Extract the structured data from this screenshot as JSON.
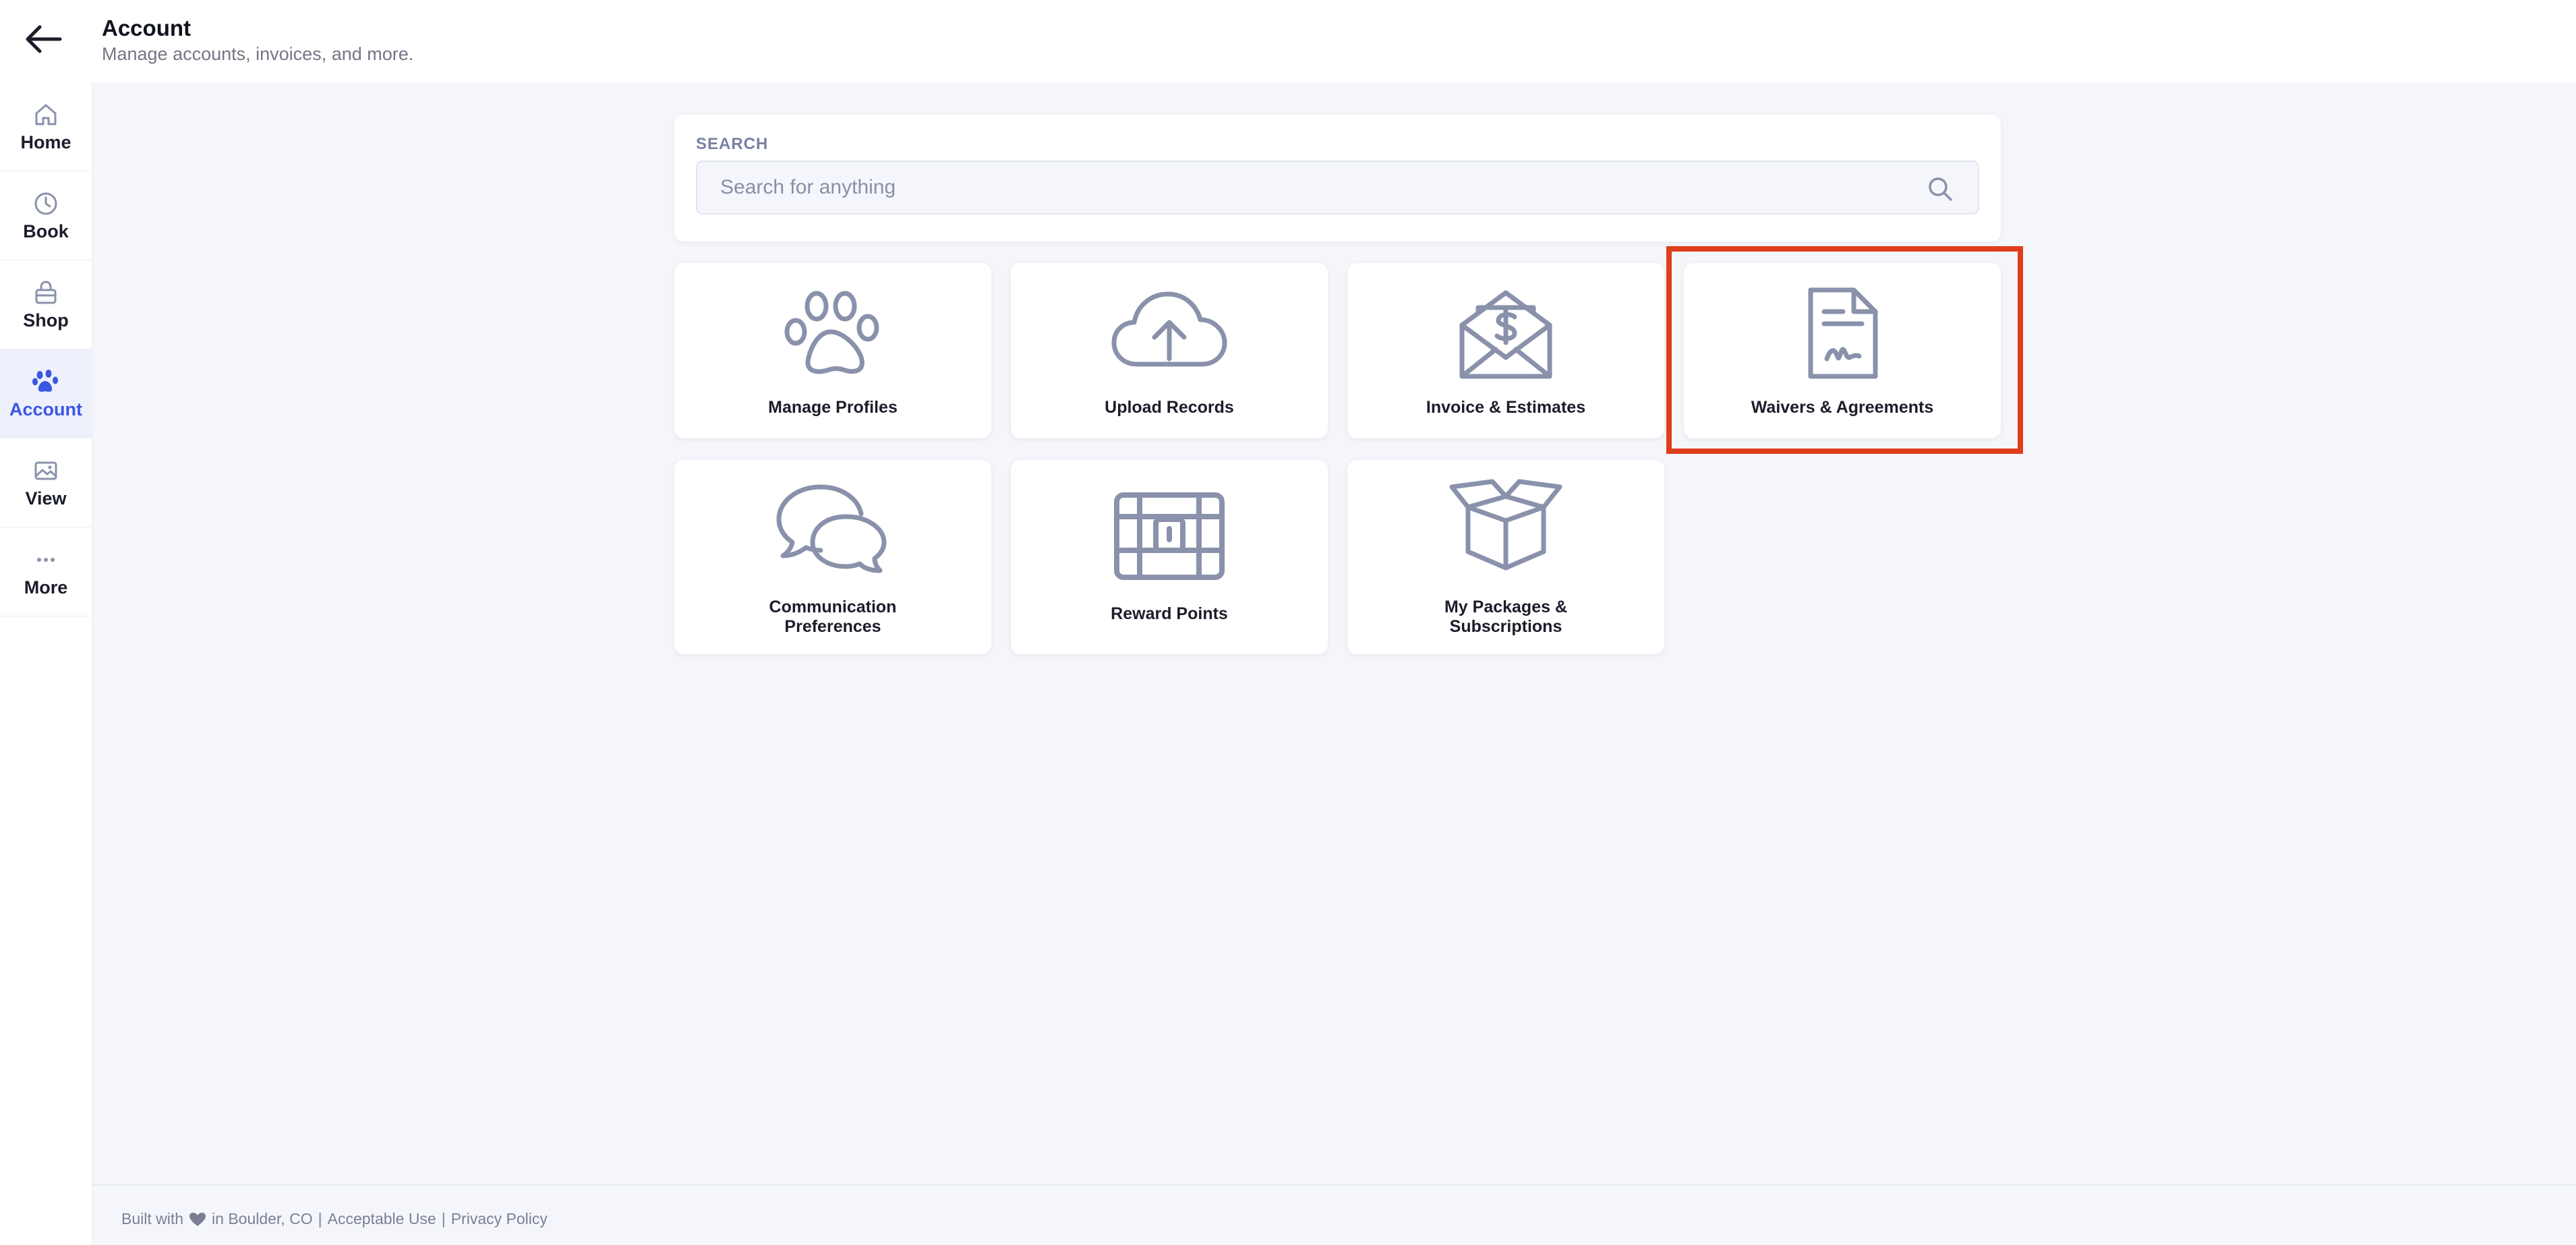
{
  "header": {
    "title": "Account",
    "subtitle": "Manage accounts, invoices, and more.",
    "back_icon": "arrow-left-icon"
  },
  "sidebar": {
    "items": [
      {
        "label": "Home",
        "icon": "home-icon",
        "active": false
      },
      {
        "label": "Book",
        "icon": "clock-icon",
        "active": false
      },
      {
        "label": "Shop",
        "icon": "shopping-bag-icon",
        "active": false
      },
      {
        "label": "Account",
        "icon": "paw-icon",
        "active": true
      },
      {
        "label": "View",
        "icon": "image-icon",
        "active": false
      },
      {
        "label": "More",
        "icon": "more-dots-icon",
        "active": false
      }
    ]
  },
  "search": {
    "label": "SEARCH",
    "placeholder": "Search for anything",
    "value": ""
  },
  "tiles": [
    {
      "label": "Manage Profiles",
      "icon": "paw-icon"
    },
    {
      "label": "Upload Records",
      "icon": "cloud-upload-icon"
    },
    {
      "label": "Invoice & Estimates",
      "icon": "envelope-dollar-icon"
    },
    {
      "label": "Waivers & Agreements",
      "icon": "signed-document-icon",
      "highlighted": true
    },
    {
      "label": "Communication Preferences",
      "line1": "Communication",
      "line2": "Preferences",
      "icon": "chat-bubbles-icon"
    },
    {
      "label": "Reward Points",
      "icon": "treasure-chest-icon"
    },
    {
      "label": "My Packages & Subscriptions",
      "line1": "My Packages &",
      "line2": "Subscriptions",
      "icon": "open-box-icon"
    }
  ],
  "footer": {
    "built_with": "Built with",
    "location": "in Boulder, CO",
    "separator": "|",
    "acceptable_use": "Acceptable Use",
    "privacy_policy": "Privacy Policy"
  },
  "colors": {
    "accent": "#3b57e0",
    "icon_gray": "#8a91ab",
    "highlight": "#e03e1c",
    "background": "#f5f6fb"
  }
}
